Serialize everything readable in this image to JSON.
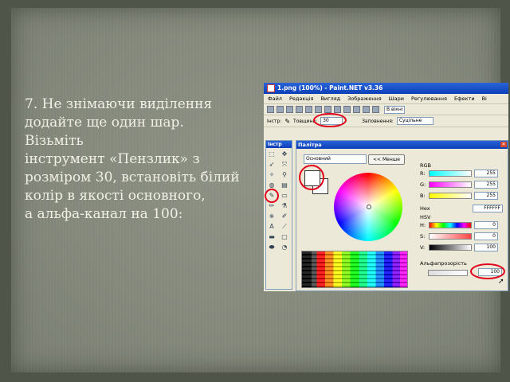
{
  "slide": {
    "lines": [
      "7. Не знімаючи виділення",
      "додайте ще один шар.",
      "Візьміть",
      "інструмент «Пензлик» з",
      "розміром 30, встановіть білий",
      "колір в якості основного,",
      "а альфа-канал на 100:"
    ]
  },
  "app": {
    "title": "1.png (100%) - Paint.NET v3.36",
    "menu": [
      "Файл",
      "Редакція",
      "Вигляд",
      "Зображення",
      "Шари",
      "Регулювання",
      "Ефекти",
      "Ві"
    ],
    "toolbar": {
      "window_label": "В вікні"
    },
    "options": {
      "tool_label": "Інстр:",
      "width_label": "Товщина:",
      "width_value": "30",
      "fill_label": "Заповнення:",
      "fill_value": "Суцільне"
    }
  },
  "tools_panel": {
    "title": "Інстр"
  },
  "palette": {
    "title": "Палітра",
    "mode_select": "Основний",
    "less_button": "<< Менше",
    "rgb_label": "RGB",
    "r_label": "R:",
    "r_value": "255",
    "g_label": "G:",
    "g_value": "255",
    "b_label": "B:",
    "b_value": "255",
    "hex_label": "Hex",
    "hex_value": "FFFFFF",
    "hsv_label": "HSV",
    "h_label": "H:",
    "h_value": "0",
    "s_label": "S:",
    "s_value": "0",
    "v_label": "V:",
    "v_value": "100",
    "alpha_label": "Альфапрозорість",
    "alpha_value": "100"
  },
  "colors": {
    "highlight": "#e0001b",
    "title_blue": "#0a3fb8",
    "primary_color": "#FFFFFF"
  }
}
